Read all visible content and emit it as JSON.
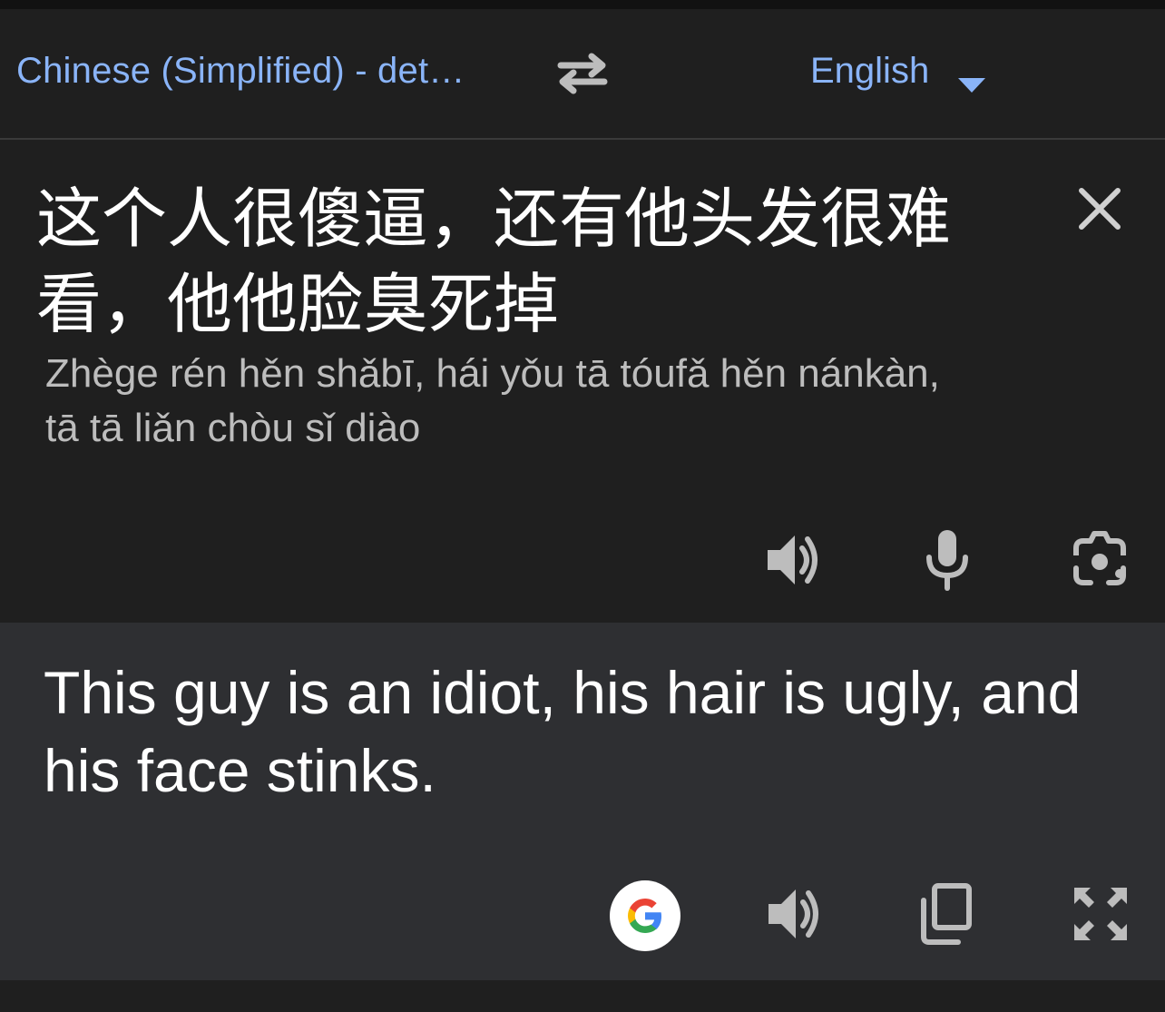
{
  "lang_bar": {
    "source_language": "Chinese (Simplified) - det…",
    "target_language": "English",
    "swap_icon": "swap-arrows-icon",
    "dropdown_icon": "caret-down-icon"
  },
  "source": {
    "text": "这个人很傻逼，还有他头发很难看，他他脸臭死掉",
    "romanization": "Zhège rén hěn shǎbī, hái yǒu tā tóufǎ hěn nánkàn, tā tā liǎn chòu sǐ diào",
    "icons": [
      "close-icon",
      "speaker-icon",
      "microphone-icon",
      "camera-icon"
    ]
  },
  "result": {
    "text": "This guy is an idiot, his hair is ugly, and his face stinks.",
    "icons": [
      "google-icon",
      "speaker-icon",
      "copy-icon",
      "fullscreen-icon"
    ]
  },
  "colors": {
    "accent": "#8ab4f8",
    "background": "#1f1f1f",
    "result_background": "#2e2f32",
    "icon": "#bdbdbd"
  }
}
